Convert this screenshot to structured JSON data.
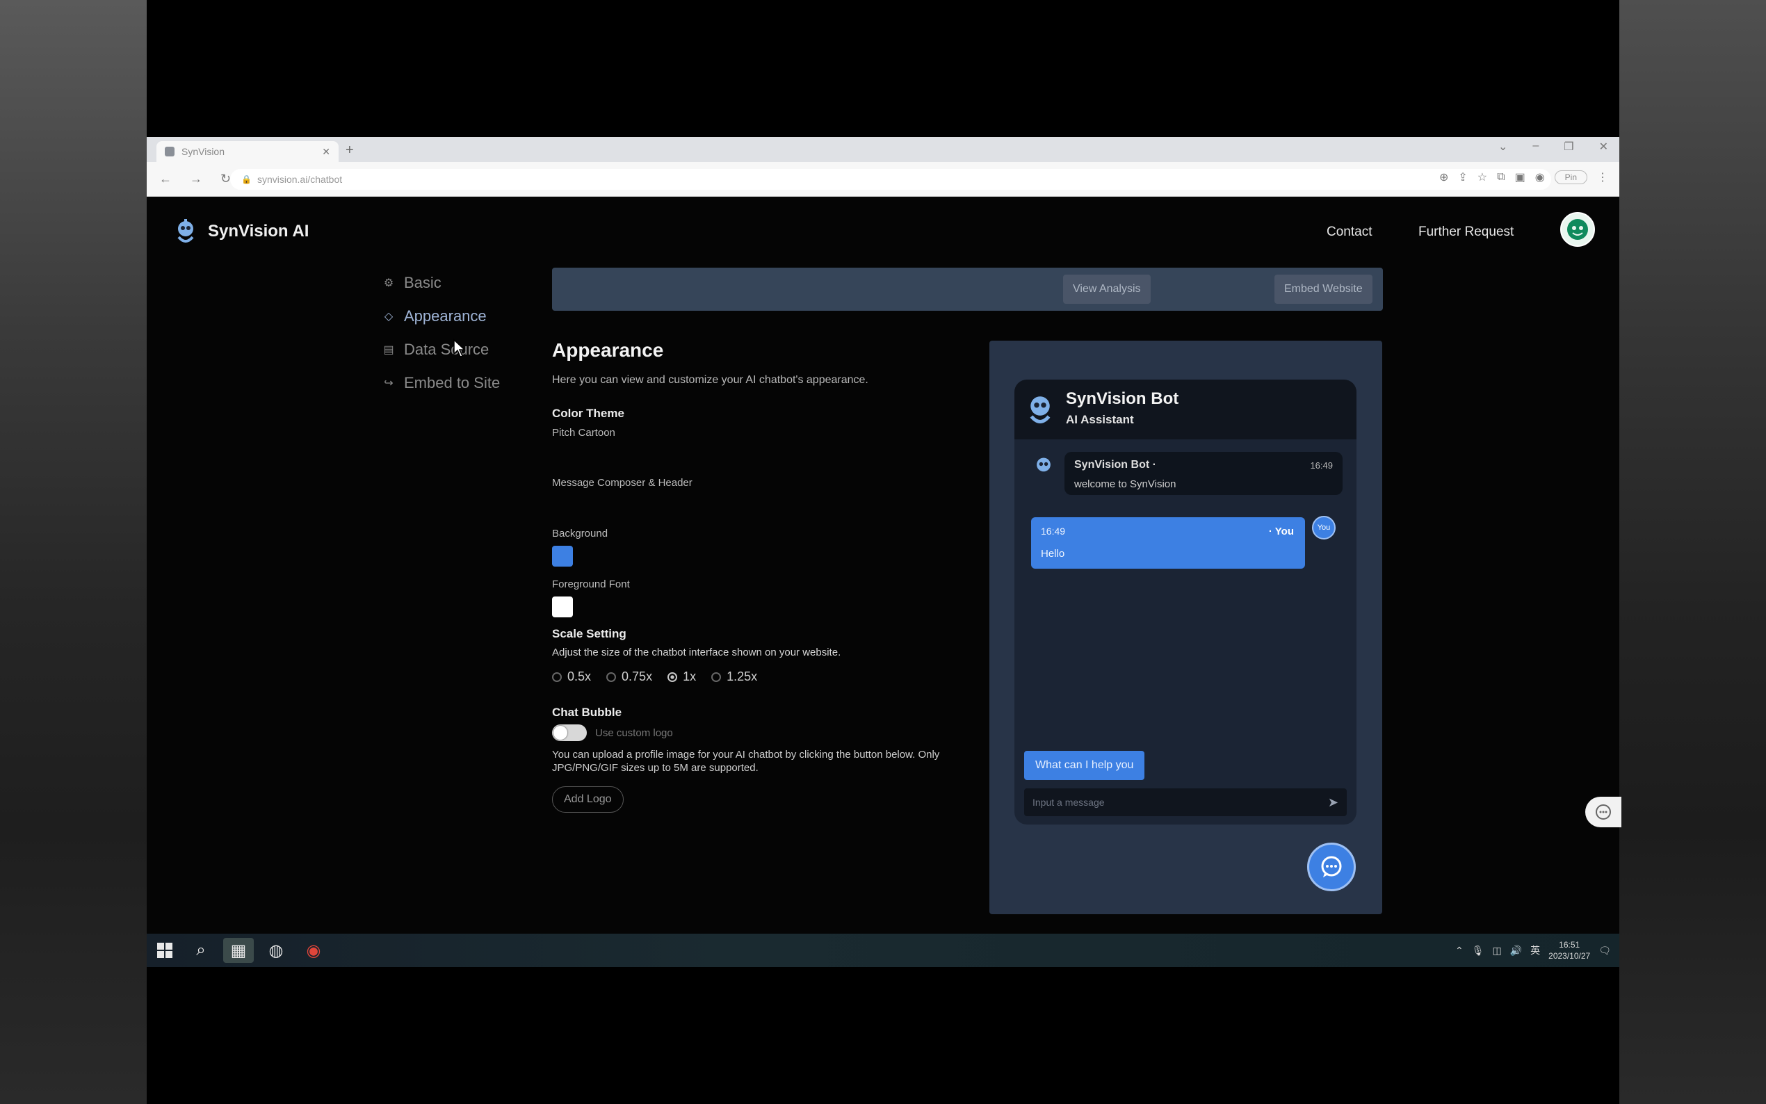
{
  "browser": {
    "tab_title": "SynVision",
    "url": "synvision.ai/chatbot",
    "profile_label": "Pin"
  },
  "brand": {
    "name": "SynVision AI"
  },
  "topnav": {
    "contact": "Contact",
    "further_request": "Further Request"
  },
  "sidebar": {
    "items": [
      {
        "label": "Basic",
        "icon": "settings-icon"
      },
      {
        "label": "Appearance",
        "icon": "appearance-icon",
        "active": true
      },
      {
        "label": "Data Source",
        "icon": "data-source-icon"
      },
      {
        "label": "Embed to Site",
        "icon": "embed-icon"
      }
    ]
  },
  "actions": {
    "view_analysis": "View Analysis",
    "embed_website": "Embed Website"
  },
  "appearance": {
    "title": "Appearance",
    "description": "Here you can view and customize your AI chatbot's appearance.",
    "color_theme": {
      "heading": "Color Theme",
      "style_value": "Pitch Cartoon",
      "message_label": "Message Composer & Header",
      "background_label": "Background",
      "background_color": "#3d80e3",
      "foreground_label": "Foreground Font",
      "foreground_color": "#ffffff"
    },
    "scale": {
      "heading": "Scale Setting",
      "description": "Adjust the size of the chatbot interface shown on your website.",
      "options": [
        "0.5x",
        "0.75x",
        "1x",
        "1.25x"
      ],
      "selected": "1x"
    },
    "chat_bubble": {
      "heading": "Chat Bubble",
      "toggle_label": "Use custom logo",
      "toggle_on": false,
      "note": "You can upload a profile image for your AI chatbot by clicking the button below. Only JPG/PNG/GIF sizes up to 5M are supported.",
      "add_logo": "Add Logo"
    }
  },
  "preview": {
    "bot_name": "SynVision Bot",
    "bot_subtitle": "AI Assistant",
    "bot_message": {
      "sender": "SynVision Bot ·",
      "time": "16:49",
      "text": "welcome to SynVision"
    },
    "user_message": {
      "time": "16:49",
      "sender": "· You",
      "text": "Hello",
      "avatar_text": "You"
    },
    "quick_reply": "What can I help you",
    "composer_placeholder": "Input a message"
  },
  "taskbar": {
    "time": "16:51",
    "date": "2023/10/27"
  },
  "colors": {
    "accent": "#3d80e3",
    "panel": "#283448",
    "actionbar": "#364559",
    "app_bg": "#050505"
  }
}
